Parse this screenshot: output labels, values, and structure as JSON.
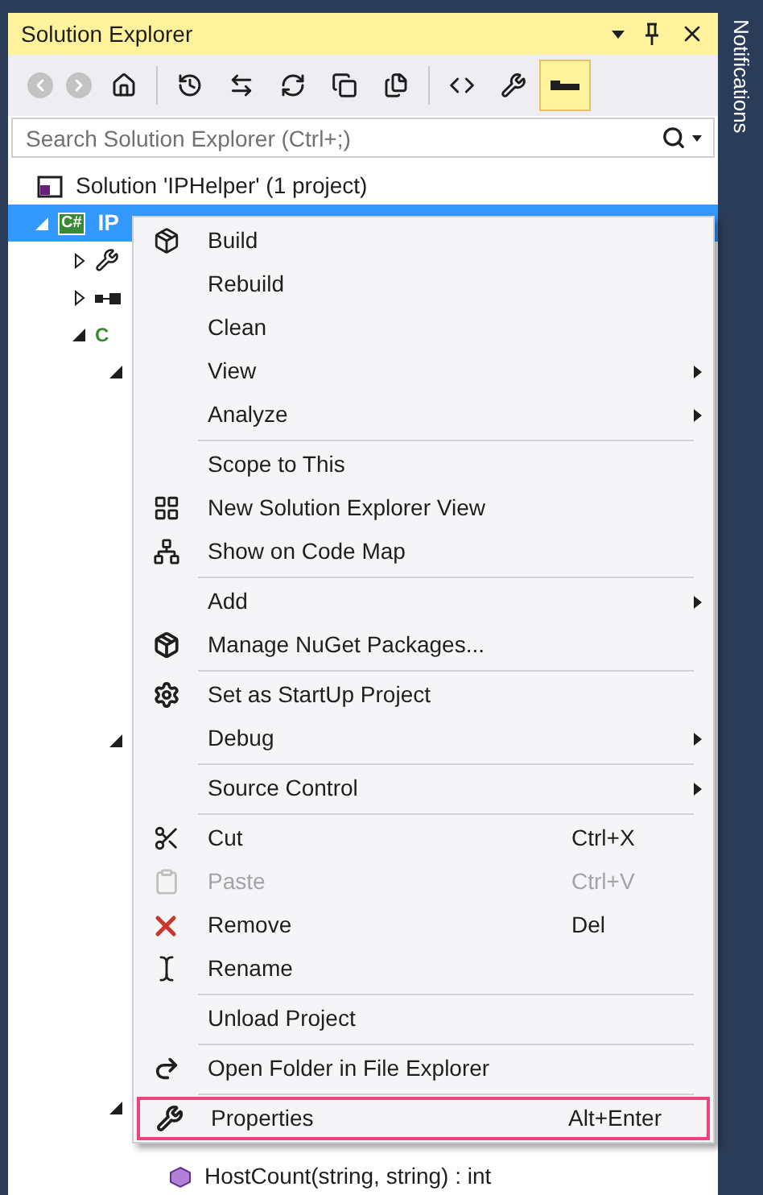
{
  "panel": {
    "title": "Solution Explorer",
    "search": {
      "placeholder": "Search Solution Explorer (Ctrl+;)"
    },
    "toolbar": [
      {
        "kind": "back",
        "disabled": true
      },
      {
        "kind": "forward",
        "disabled": true
      },
      {
        "kind": "home"
      },
      {
        "kind": "separator"
      },
      {
        "kind": "history"
      },
      {
        "kind": "sync"
      },
      {
        "kind": "refresh"
      },
      {
        "kind": "collapse"
      },
      {
        "kind": "files"
      },
      {
        "kind": "separator"
      },
      {
        "kind": "code"
      },
      {
        "kind": "properties"
      },
      {
        "kind": "preview",
        "selected": true
      }
    ],
    "tree": [
      {
        "kind": "solution",
        "label": "Solution 'IPHelper' (1 project)",
        "children": [
          {
            "kind": "project",
            "badge": "C#",
            "label": "IP",
            "selected": true,
            "expanded": true,
            "children": [
              {
                "kind": "properties",
                "expanded": false
              },
              {
                "kind": "references",
                "expanded": false
              },
              {
                "kind": "csfile",
                "badge": "C",
                "expanded": true,
                "children": [
                  {
                    "expanded": true
                  },
                  {
                    "expanded": true
                  },
                  {
                    "expanded": true,
                    "children": [
                      {
                        "kind": "method",
                        "label": "HostCount(string, string) : int"
                      }
                    ]
                  }
                ]
              }
            ]
          }
        ]
      }
    ]
  },
  "side_tab": "Notifications",
  "context_menu": [
    {
      "kind": "item",
      "label": "Build"
    },
    {
      "kind": "item",
      "label": "Rebuild"
    },
    {
      "kind": "item",
      "label": "Clean"
    },
    {
      "kind": "item",
      "label": "View",
      "submenu": true
    },
    {
      "kind": "item",
      "label": "Analyze",
      "submenu": true
    },
    {
      "kind": "separator"
    },
    {
      "kind": "item",
      "label": "Scope to This"
    },
    {
      "kind": "item",
      "label": "New Solution Explorer View"
    },
    {
      "kind": "item",
      "label": "Show on Code Map"
    },
    {
      "kind": "separator"
    },
    {
      "kind": "item",
      "label": "Add",
      "submenu": true
    },
    {
      "kind": "item",
      "label": "Manage NuGet Packages..."
    },
    {
      "kind": "separator"
    },
    {
      "kind": "item",
      "label": "Set as StartUp Project"
    },
    {
      "kind": "item",
      "label": "Debug",
      "submenu": true
    },
    {
      "kind": "separator"
    },
    {
      "kind": "item",
      "label": "Source Control",
      "submenu": true
    },
    {
      "kind": "separator"
    },
    {
      "kind": "item",
      "label": "Cut",
      "shortcut": "Ctrl+X"
    },
    {
      "kind": "item",
      "label": "Paste",
      "shortcut": "Ctrl+V",
      "disabled": true
    },
    {
      "kind": "item",
      "label": "Remove",
      "shortcut": "Del"
    },
    {
      "kind": "item",
      "label": "Rename"
    },
    {
      "kind": "separator"
    },
    {
      "kind": "item",
      "label": "Unload Project"
    },
    {
      "kind": "separator"
    },
    {
      "kind": "item",
      "label": "Open Folder in File Explorer"
    },
    {
      "kind": "separator"
    },
    {
      "kind": "item",
      "label": "Properties",
      "shortcut": "Alt+Enter",
      "highlighted": true
    }
  ]
}
